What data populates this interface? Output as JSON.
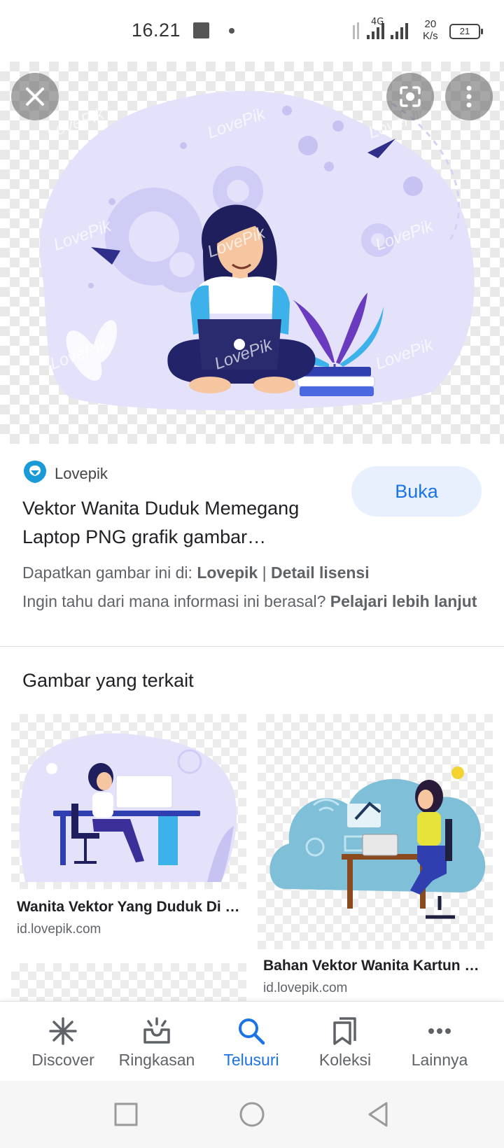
{
  "status_bar": {
    "time": "16.21",
    "network": "4G",
    "speed_value": "20",
    "speed_unit": "K/s",
    "battery": "21"
  },
  "hero": {
    "watermark": "LovePik",
    "close_icon": "close-icon",
    "lens_icon": "lens-icon",
    "menu_icon": "more-vert-icon"
  },
  "result": {
    "source_name": "Lovepik",
    "title": "Vektor Wanita Duduk Memegang Laptop PNG grafik gambar…",
    "open_label": "Buka",
    "get_image_prefix": "Dapatkan gambar ini di:",
    "get_image_source": "Lovepik",
    "separator": "|",
    "license_label": "Detail lisensi",
    "info_question": "Ingin tahu dari mana informasi ini berasal?",
    "learn_more": "Pelajari lebih lanjut"
  },
  "related": {
    "heading": "Gambar yang terkait",
    "items": [
      {
        "title": "Wanita Vektor Yang Duduk Di …",
        "domain": "id.lovepik.com"
      },
      {
        "title": "Bahan Vektor Wanita Kartun …",
        "domain": "id.lovepik.com"
      }
    ]
  },
  "bottom_nav": {
    "items": [
      {
        "label": "Discover",
        "icon": "asterisk-icon"
      },
      {
        "label": "Ringkasan",
        "icon": "inbox-icon"
      },
      {
        "label": "Telusuri",
        "icon": "search-icon"
      },
      {
        "label": "Koleksi",
        "icon": "bookmarks-icon"
      },
      {
        "label": "Lainnya",
        "icon": "more-horiz-icon"
      }
    ],
    "active": "Telusuri"
  },
  "colors": {
    "accent": "#1a73e8",
    "accent_bg": "#e8f0fe",
    "text_secondary": "#5f6368",
    "illustration_purple": "#2a2a6e",
    "illustration_lavender": "#e4e2fa"
  }
}
